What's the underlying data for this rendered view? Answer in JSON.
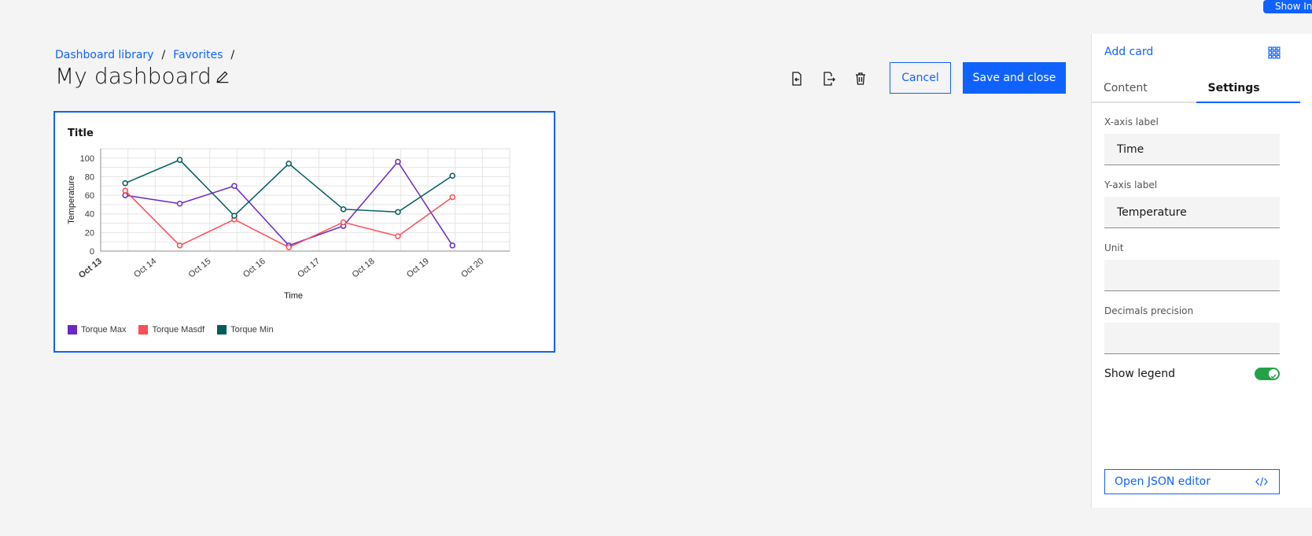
{
  "show_info_label": "Show Info",
  "breadcrumb": {
    "items": [
      "Dashboard library",
      "Favorites"
    ],
    "separator": "/"
  },
  "page_title": "My dashboard",
  "toolbar": {
    "cancel_label": "Cancel",
    "save_label": "Save and close"
  },
  "card": {
    "title": "Title"
  },
  "chart_data": {
    "type": "line",
    "x": [
      "Oct 13",
      "Oct 14",
      "Oct 15",
      "Oct 16",
      "Oct 17",
      "Oct 18",
      "Oct 19",
      "Oct 20"
    ],
    "xlabel": "Time",
    "ylabel": "Temperature",
    "ylim": [
      0,
      110
    ],
    "yticks": [
      0,
      20,
      40,
      60,
      80,
      100
    ],
    "grid": true,
    "legend": "bottom-left",
    "series": [
      {
        "name": "Torque Max",
        "color": "#6929c4",
        "points": [
          [
            0.45,
            60
          ],
          [
            1.45,
            51
          ],
          [
            2.45,
            70
          ],
          [
            3.45,
            6
          ],
          [
            4.45,
            27
          ],
          [
            5.45,
            96
          ],
          [
            6.45,
            6
          ]
        ]
      },
      {
        "name": "Torque Masdf",
        "color": "#fa4d56",
        "points": [
          [
            0.45,
            65
          ],
          [
            1.45,
            6
          ],
          [
            2.45,
            34
          ],
          [
            3.45,
            4
          ],
          [
            4.45,
            31
          ],
          [
            5.45,
            16
          ],
          [
            6.45,
            58
          ]
        ]
      },
      {
        "name": "Torque Min",
        "color": "#005d5d",
        "points": [
          [
            0.45,
            73
          ],
          [
            1.45,
            98
          ],
          [
            2.45,
            38
          ],
          [
            3.45,
            94
          ],
          [
            4.45,
            45
          ],
          [
            5.45,
            42
          ],
          [
            6.45,
            81
          ]
        ]
      }
    ]
  },
  "panel": {
    "add_card_label": "Add card",
    "tabs": [
      "Content",
      "Settings"
    ],
    "active_tab": "Settings",
    "fields": [
      {
        "label": "X-axis label",
        "value": "Time"
      },
      {
        "label": "Y-axis label",
        "value": "Temperature"
      },
      {
        "label": "Unit",
        "value": ""
      },
      {
        "label": "Decimals precision",
        "value": ""
      }
    ],
    "show_legend_label": "Show legend",
    "show_legend_on": true,
    "json_editor_label": "Open JSON editor"
  }
}
